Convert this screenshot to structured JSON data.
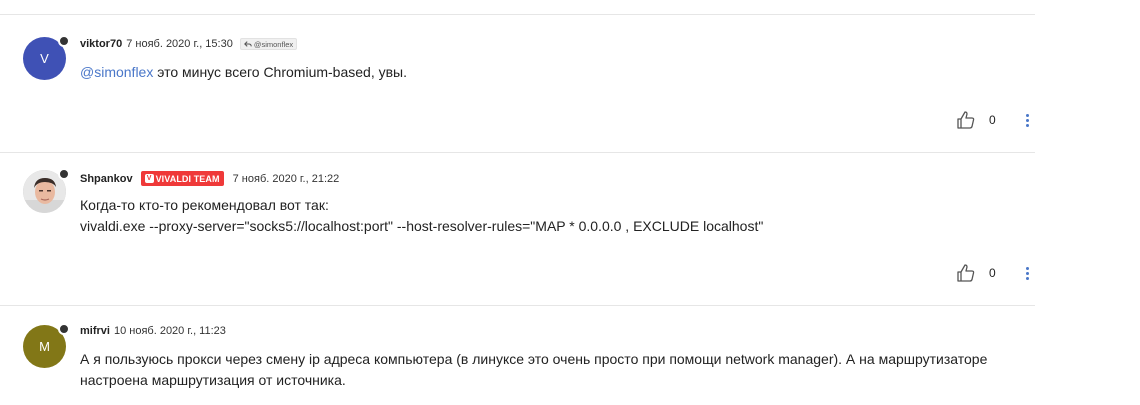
{
  "posts": [
    {
      "avatar": {
        "letter": "V",
        "color": "#3f51b5"
      },
      "username": "viktor70",
      "timestamp": "7 нояб. 2020 г., 15:30",
      "reply_to": "@simonflex",
      "mention": "@simonflex",
      "text": " это минус всего Chromium-based, увы.",
      "votes": "0"
    },
    {
      "avatar": {
        "type": "photo"
      },
      "username": "Shpankov",
      "badge": "VIVALDI TEAM",
      "timestamp": "7 нояб. 2020 г., 21:22",
      "lines": [
        "Когда-то кто-то рекомендовал вот так:",
        "vivaldi.exe --proxy-server=\"socks5://localhost:port\" --host-resolver-rules=\"MAP * 0.0.0.0 , EXCLUDE localhost\""
      ],
      "votes": "0"
    },
    {
      "avatar": {
        "letter": "M",
        "color": "#827717"
      },
      "username": "mifrvi",
      "timestamp": "10 нояб. 2020 г., 11:23",
      "lines": [
        "А я пользуюсь прокси через смену ip адреса компьютера (в линуксе это очень просто при помощи network manager). А на маршрутизаторе",
        "настроена маршрутизация от источника."
      ]
    }
  ],
  "colors": {
    "accent": "#4a77c9",
    "badge": "#ef3939",
    "divider": "#e6e6e6"
  },
  "icons": [
    "thumbs-up-icon",
    "more-vertical-icon",
    "reply-icon",
    "vivaldi-logo-icon"
  ]
}
